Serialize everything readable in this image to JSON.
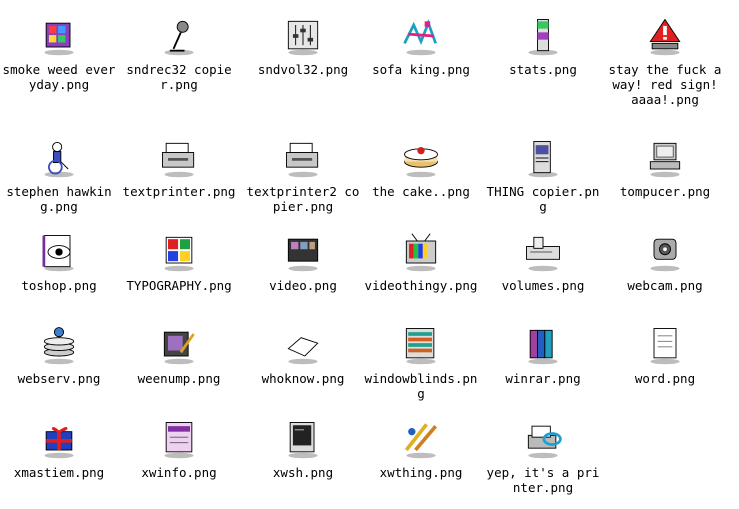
{
  "files": [
    {
      "label": "smoke weed everyday.png",
      "icon": "colorful-cube-icon"
    },
    {
      "label": "sndrec32 copier.png",
      "icon": "microphone-icon"
    },
    {
      "label": "sndvol32.png",
      "icon": "volume-slider-icon"
    },
    {
      "label": "sofa king.png",
      "icon": "graffiti-icon"
    },
    {
      "label": "stats.png",
      "icon": "stats-bar-icon"
    },
    {
      "label": "stay the fuck away! red sign! aaaa!.png",
      "icon": "red-warning-sign-icon"
    },
    {
      "label": "stephen hawking.png",
      "icon": "wheelchair-icon"
    },
    {
      "label": "textprinter.png",
      "icon": "printer-icon"
    },
    {
      "label": "textprinter2 copier.png",
      "icon": "printer-icon"
    },
    {
      "label": "the cake..png",
      "icon": "cake-icon"
    },
    {
      "label": "THING copier.png",
      "icon": "tower-device-icon"
    },
    {
      "label": "tompucer.png",
      "icon": "computer-icon"
    },
    {
      "label": "toshop.png",
      "icon": "eye-icon"
    },
    {
      "label": "TYPOGRAPHY.png",
      "icon": "color-grid-icon"
    },
    {
      "label": "video.png",
      "icon": "film-strip-icon"
    },
    {
      "label": "videothingy.png",
      "icon": "tv-icon"
    },
    {
      "label": "volumes.png",
      "icon": "drive-icon"
    },
    {
      "label": "webcam.png",
      "icon": "webcam-icon"
    },
    {
      "label": "webserv.png",
      "icon": "server-stack-icon"
    },
    {
      "label": "weenump.png",
      "icon": "player-icon"
    },
    {
      "label": "whoknow.png",
      "icon": "paper-sheet-icon"
    },
    {
      "label": "windowblinds.png",
      "icon": "window-blinds-icon"
    },
    {
      "label": "winrar.png",
      "icon": "books-icon"
    },
    {
      "label": "word.png",
      "icon": "document-icon"
    },
    {
      "label": "xmastiem.png",
      "icon": "gift-icon"
    },
    {
      "label": "xwinfo.png",
      "icon": "info-window-icon"
    },
    {
      "label": "xwsh.png",
      "icon": "terminal-icon"
    },
    {
      "label": "xwthing.png",
      "icon": "xw-thing-icon"
    },
    {
      "label": "yep, it's a printer.png",
      "icon": "fancy-printer-icon"
    }
  ]
}
